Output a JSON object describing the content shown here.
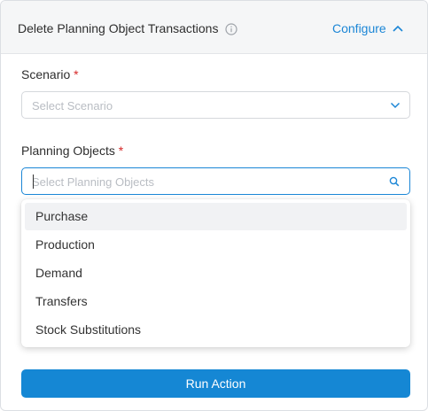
{
  "header": {
    "title": "Delete Planning Object Transactions",
    "info_icon": "info-circle-icon",
    "configure_label": "Configure",
    "collapse_icon": "chevron-up-icon"
  },
  "scenario": {
    "label": "Scenario",
    "required_mark": "*",
    "placeholder": "Select Scenario",
    "icon": "chevron-down-icon"
  },
  "planning_objects": {
    "label": "Planning Objects",
    "required_mark": "*",
    "placeholder": "Select Planning Objects",
    "icon": "search-icon",
    "options": [
      "Purchase",
      "Production",
      "Demand",
      "Transfers",
      "Stock Substitutions"
    ],
    "highlighted_option": "Purchase"
  },
  "run_button": {
    "label": "Run Action"
  },
  "colors": {
    "accent": "#1587d4",
    "required": "#d62828",
    "header_bg": "#f5f6f7"
  }
}
